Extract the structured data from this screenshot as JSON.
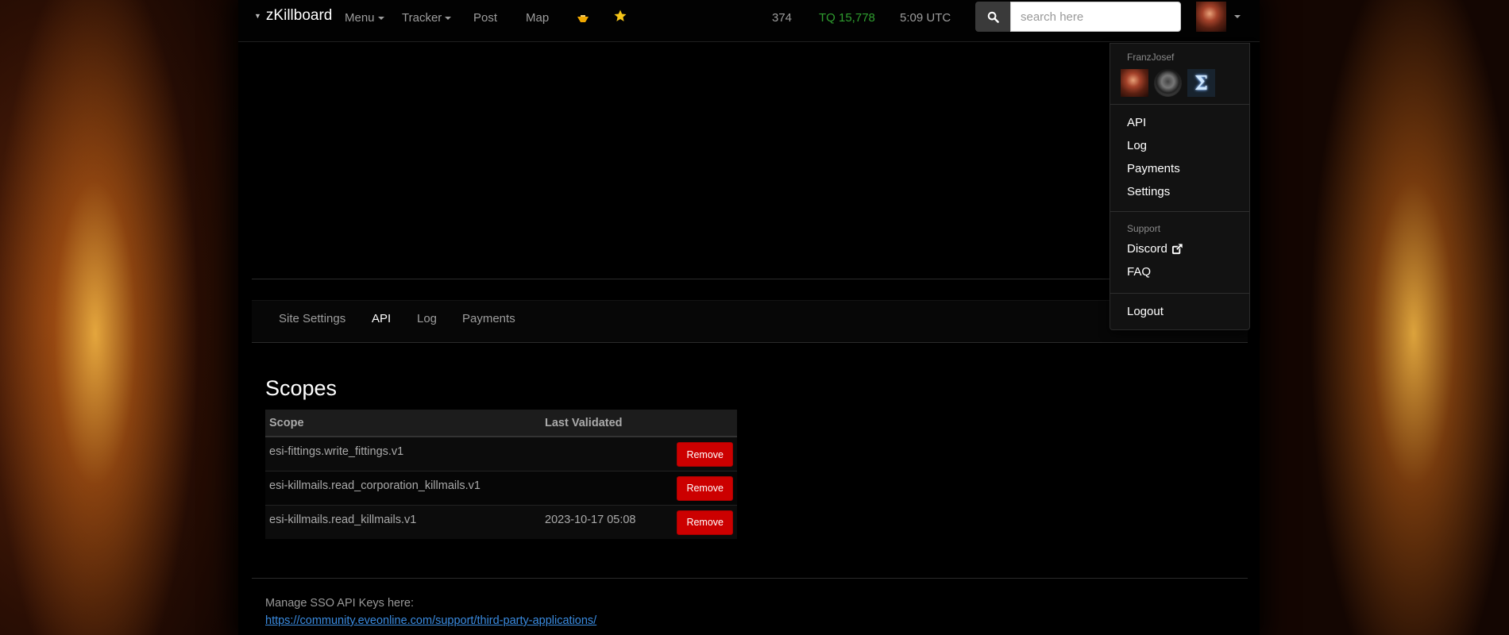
{
  "navbar": {
    "brand": "zKillboard",
    "menu_label": "Menu",
    "tracker_label": "Tracker",
    "post_label": "Post",
    "map_label": "Map",
    "online_count": "374",
    "tq_status": "TQ 15,778",
    "time": "5:09 UTC",
    "search_placeholder": "search here"
  },
  "tabs": [
    {
      "label": "Site Settings"
    },
    {
      "label": "API"
    },
    {
      "label": "Log"
    },
    {
      "label": "Payments"
    }
  ],
  "scopes": {
    "title": "Scopes",
    "columns": [
      "Scope",
      "Last Validated"
    ],
    "rows": [
      {
        "scope": "esi-fittings.write_fittings.v1",
        "last_validated": "",
        "action": "Remove"
      },
      {
        "scope": "esi-killmails.read_corporation_killmails.v1",
        "last_validated": "",
        "action": "Remove"
      },
      {
        "scope": "esi-killmails.read_killmails.v1",
        "last_validated": "2023-10-17 05:08",
        "action": "Remove"
      }
    ]
  },
  "sso": {
    "note": "Manage SSO API Keys here:",
    "link": "https://community.eveonline.com/support/third-party-applications/"
  },
  "dropdown": {
    "username": "FranzJosef",
    "items": [
      "API",
      "Log",
      "Payments",
      "Settings"
    ],
    "support_header": "Support",
    "support_items": [
      "Discord",
      "FAQ"
    ],
    "logout": "Logout"
  },
  "colors": {
    "tq_status": "#2f9e2f",
    "remove_button": "#cc0000",
    "link": "#3a8be0",
    "star": "#f5c518"
  },
  "icons": [
    "search-icon",
    "star-icon",
    "external-link-icon",
    "caret-down-icon"
  ]
}
